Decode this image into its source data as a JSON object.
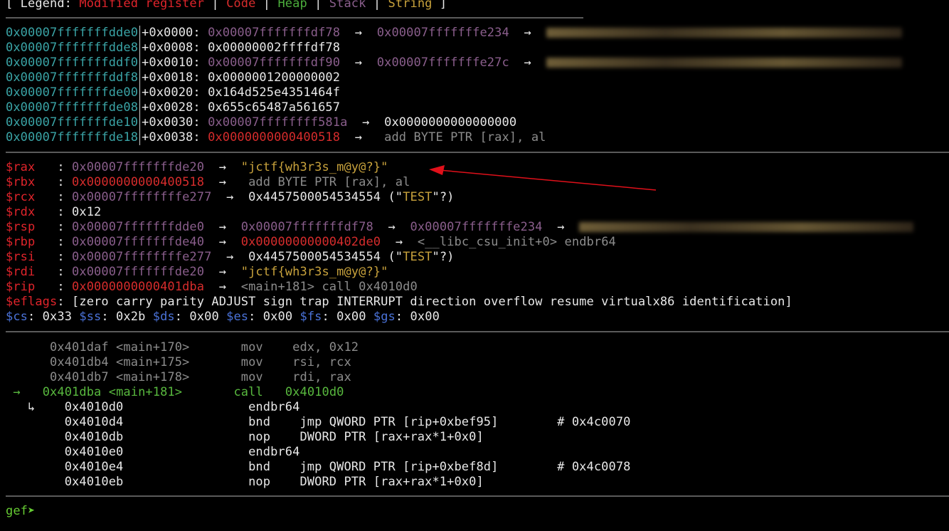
{
  "legend": {
    "prefix": "[ Legend: ",
    "items": [
      "Modified register",
      "Code",
      "Heap",
      "Stack",
      "String"
    ],
    "sep": " | ",
    "suffix": " ]"
  },
  "stack": [
    {
      "addr": "0x00007fffffffdde0",
      "off": "+0x0000:",
      "val": "0x00007fffffffdf78",
      "a1": "→",
      "val2": "0x00007fffffffe234",
      "a2": "→"
    },
    {
      "addr": "0x00007fffffffdde8",
      "off": "+0x0008:",
      "val": "0x00000002ffffdf78"
    },
    {
      "addr": "0x00007fffffffddf0",
      "off": "+0x0010:",
      "val": "0x00007fffffffdf90",
      "a1": "→",
      "val2": "0x00007fffffffe27c",
      "a2": "→"
    },
    {
      "addr": "0x00007fffffffddf8",
      "off": "+0x0018:",
      "val": "0x0000001200000002"
    },
    {
      "addr": "0x00007fffffffde00",
      "off": "+0x0020:",
      "val": "0x164d525e4351464f"
    },
    {
      "addr": "0x00007fffffffde08",
      "off": "+0x0028:",
      "val": "0x655c65487a561657"
    },
    {
      "addr": "0x00007fffffffde10",
      "off": "+0x0030:",
      "val": "0x00007ffffffff581a",
      "a1": "→",
      "val2": "0x0000000000000000"
    },
    {
      "addr": "0x00007fffffffde18",
      "off": "+0x0038:",
      "val": "0x0000000000400518",
      "a1": "→",
      "val2": " add BYTE PTR [rax], al"
    }
  ],
  "registers": {
    "rax": {
      "name": "$rax",
      "colon": ":",
      "v": "0x00007fffffffde20",
      "a": "→",
      "s": "\"jctf{wh3r3s_m@y@?}\""
    },
    "rbx": {
      "name": "$rbx",
      "colon": ":",
      "v": "0x0000000000400518",
      "a": "→",
      "s": " add BYTE PTR [rax], al"
    },
    "rcx": {
      "name": "$rcx",
      "colon": ":",
      "v": "0x00007ffffffffe277",
      "a": "→",
      "v2": "0x4457500054534554 (\"",
      "s": "TEST",
      "t": "\"?)"
    },
    "rdx": {
      "name": "$rdx",
      "colon": ":",
      "v": "0x12"
    },
    "rsp": {
      "name": "$rsp",
      "colon": ":",
      "v": "0x00007fffffffdde0",
      "a": "→",
      "v2": "0x00007fffffffdf78",
      "a2": "→",
      "v3": "0x00007fffffffe234",
      "a3": "→"
    },
    "rbp": {
      "name": "$rbp",
      "colon": ":",
      "v": "0x00007fffffffde40",
      "a": "→",
      "v2": "0x00000000000402de0",
      "a2": "→",
      "s": "<__libc_csu_init+0> endbr64"
    },
    "rsi": {
      "name": "$rsi",
      "colon": ":",
      "v": "0x00007ffffffffe277",
      "a": "→",
      "v2": "0x4457500054534554 (\"",
      "s": "TEST",
      "t": "\"?)"
    },
    "rdi": {
      "name": "$rdi",
      "colon": ":",
      "v": "0x00007fffffffde20",
      "a": "→",
      "s": "\"jctf{wh3r3s_m@y@?}\""
    },
    "rip": {
      "name": "$rip",
      "colon": ":",
      "v": "0x0000000000401dba",
      "a": "→",
      "s": "<main+181> call 0x4010d0"
    },
    "eflags": {
      "name": "$eflags",
      "v": ": [zero carry parity ADJUST sign trap INTERRUPT direction overflow resume virtualx86 identification]"
    },
    "segs": [
      {
        "n": "$cs",
        "v": ": 0x33 "
      },
      {
        "n": "$ss",
        "v": ": 0x2b "
      },
      {
        "n": "$ds",
        "v": ": 0x00 "
      },
      {
        "n": "$es",
        "v": ": 0x00 "
      },
      {
        "n": "$fs",
        "v": ": 0x00 "
      },
      {
        "n": "$gs",
        "v": ": 0x00"
      }
    ]
  },
  "code": [
    {
      "addr": "0x401daf",
      "sym": "<main+170>",
      "mn": "mov",
      "ops": "edx, 0x12"
    },
    {
      "addr": "0x401db4",
      "sym": "<main+175>",
      "mn": "mov",
      "ops": "rsi, rcx"
    },
    {
      "addr": "0x401db7",
      "sym": "<main+178>",
      "mn": "mov",
      "ops": "rdi, rax"
    },
    {
      "marker": "→",
      "addr": "0x401dba",
      "sym": "<main+181>",
      "mn": "call",
      "ops": "0x4010d0"
    }
  ],
  "callee": [
    {
      "marker": "↳",
      "addr": "0x4010d0",
      "mn": "endbr64",
      "ops": "",
      "cm": ""
    },
    {
      "addr": "0x4010d4",
      "mn": "bnd",
      "ops": "jmp QWORD PTR [rip+0xbef95]",
      "cm": "# 0x4c0070"
    },
    {
      "addr": "0x4010db",
      "mn": "nop",
      "ops": "DWORD PTR [rax+rax*1+0x0]",
      "cm": ""
    },
    {
      "addr": "0x4010e0",
      "mn": "endbr64",
      "ops": "",
      "cm": ""
    },
    {
      "addr": "0x4010e4",
      "mn": "bnd",
      "ops": "jmp QWORD PTR [rip+0xbef8d]",
      "cm": "# 0x4c0078"
    },
    {
      "addr": "0x4010eb",
      "mn": "nop",
      "ops": "DWORD PTR [rax+rax*1+0x0]",
      "cm": ""
    }
  ],
  "prompt": {
    "text": "gef",
    "glyph": "➤"
  },
  "colors": {
    "modified": "#e0242b",
    "code": "#d62c2c",
    "heap": "#4cae3c",
    "stack": "#8a5e8c",
    "string": "#c8a23c",
    "address": "#3aa4a6",
    "annotation_arrow": "#e0101a"
  }
}
